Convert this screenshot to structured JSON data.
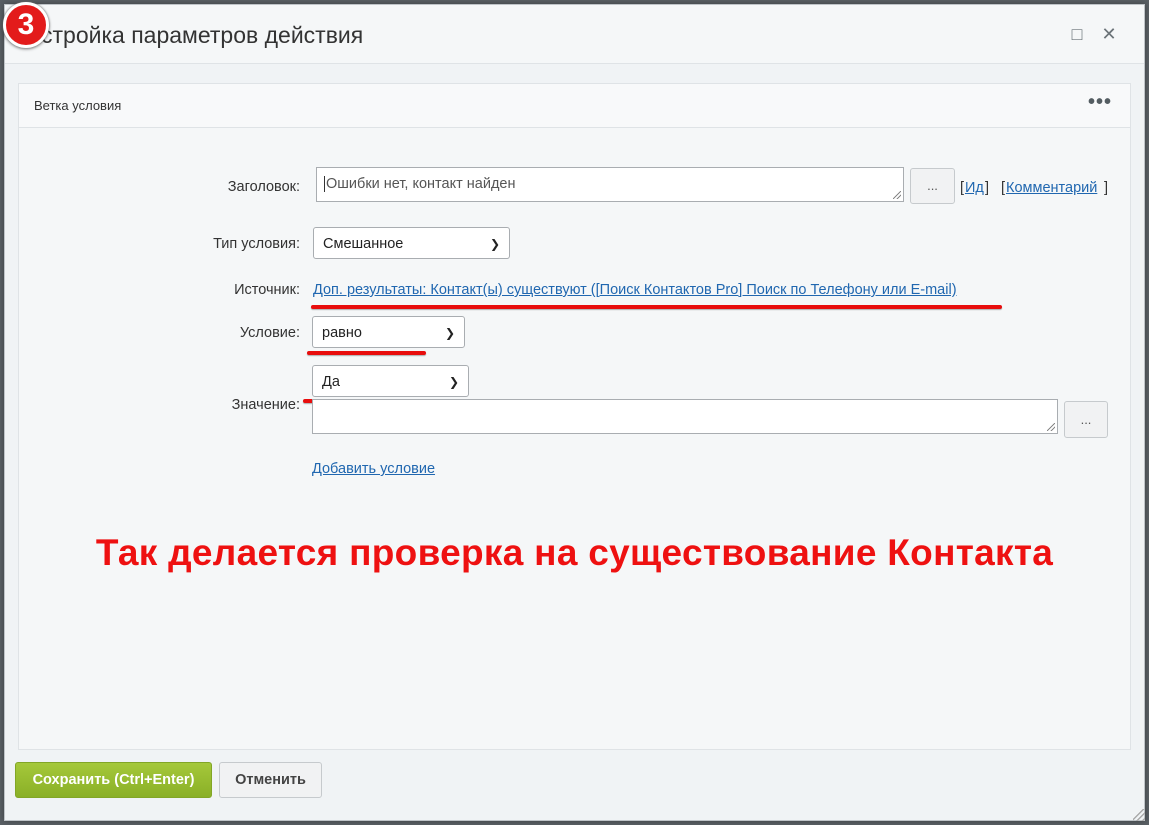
{
  "window": {
    "title": "стройка параметров действия",
    "step_badge": "3",
    "maximize_icon": "□",
    "close_icon": "✕"
  },
  "panel": {
    "title": "Ветка условия",
    "menu_icon": "•••"
  },
  "form": {
    "header_label": "Заголовок:",
    "header_value": "Ошибки нет, контакт найден",
    "header_more_button": "...",
    "id_link": "Ид",
    "comment_link": "Комментарий",
    "condition_type_label": "Тип условия:",
    "condition_type_value": "Смешанное",
    "source_label": "Источник:",
    "source_link": "Доп. результаты: Контакт(ы) существуют ([Поиск Контактов Pro] Поиск по Телефону или E-mail)",
    "condition_label": "Условие:",
    "condition_value": "равно",
    "value_label": "Значение:",
    "value_select": "Да",
    "value_text": "",
    "value_more_button": "...",
    "add_condition_link": "Добавить условие"
  },
  "annotation": {
    "text": "Так делается проверка на существование Контакта",
    "color": "#ee1111"
  },
  "footer": {
    "save_button": "Сохранить (Ctrl+Enter)",
    "cancel_button": "Отменить"
  },
  "colors": {
    "accent_green": "#9bc032",
    "link_blue": "#2067b0",
    "annotation_red": "#e80d0d"
  }
}
